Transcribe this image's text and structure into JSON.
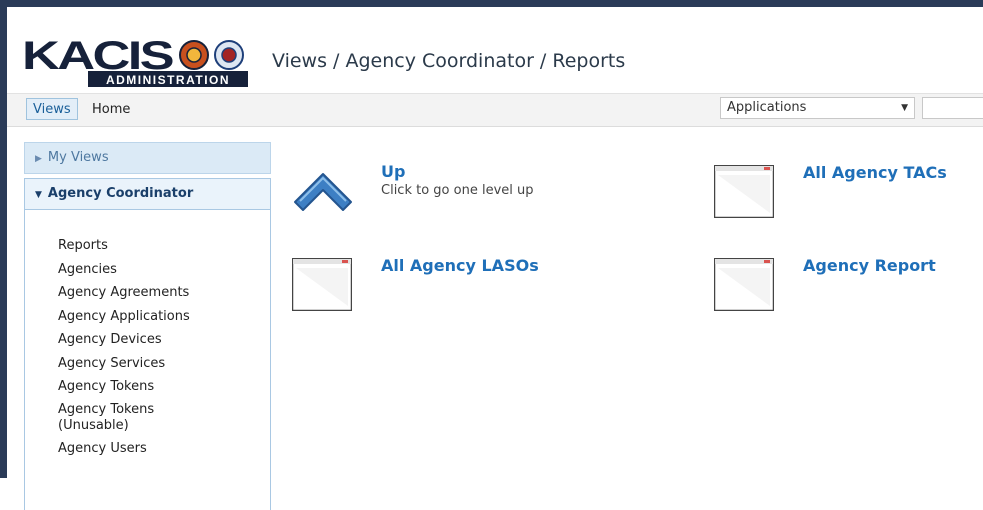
{
  "header": {
    "logo_text": "KACIS",
    "logo_subtext": "ADMINISTRATION",
    "breadcrumb": "Views / Agency Coordinator / Reports"
  },
  "topnav": {
    "views_label": "Views",
    "home_label": "Home",
    "applications_select": "Applications"
  },
  "sidebar": {
    "my_views": "My Views",
    "agency_coordinator": "Agency Coordinator",
    "links": [
      "Reports",
      "Agencies",
      "Agency Agreements",
      "Agency Applications",
      "Agency Devices",
      "Agency Services",
      "Agency Tokens",
      "Agency Tokens (Unusable)",
      "Agency Users"
    ]
  },
  "main": {
    "up_title": "Up",
    "up_desc": "Click to go one level up",
    "items": [
      "All Agency TACs",
      "All Agency LASOs",
      "Agency Report"
    ]
  },
  "colors": {
    "frame": "#2a3b58",
    "link_blue": "#1f6fb8",
    "accent_blue": "#dbeaf6"
  }
}
